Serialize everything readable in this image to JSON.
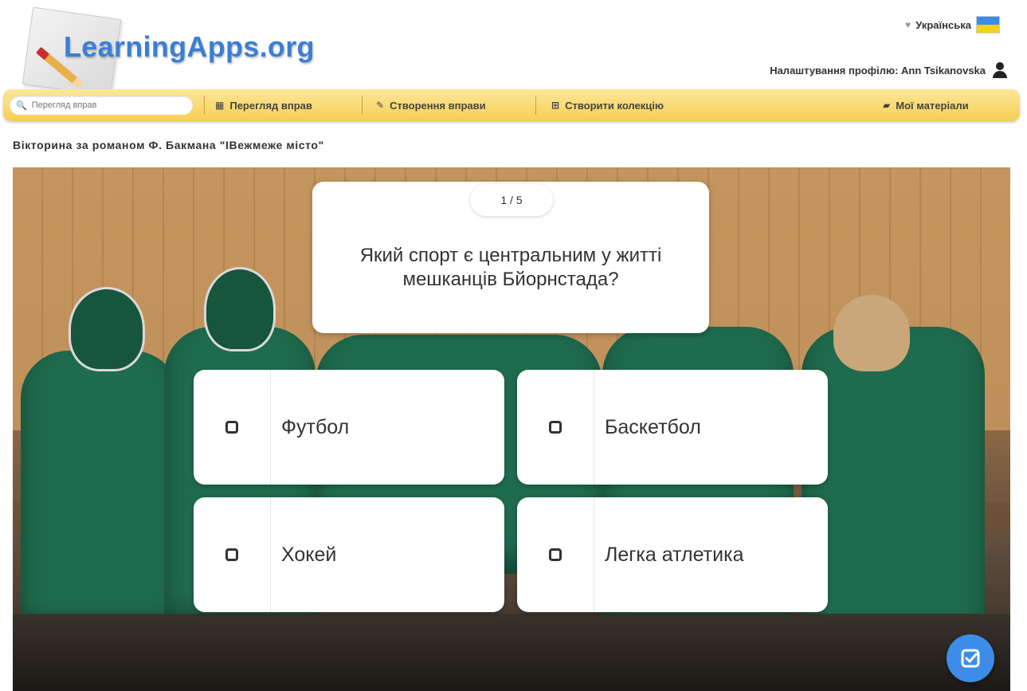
{
  "header": {
    "logo_text": "LearningApps.org",
    "language": "Українська",
    "profile_label": "Налаштування профілю: Ann Tsikanovska"
  },
  "nav": {
    "search_placeholder": "Перегляд вправ",
    "items": [
      {
        "label": "Перегляд вправ",
        "icon": "grid-icon"
      },
      {
        "label": "Створення вправи",
        "icon": "pencil-icon"
      },
      {
        "label": "Створити колекцію",
        "icon": "collection-icon"
      },
      {
        "label": "Мої матеріали",
        "icon": "folder-icon"
      }
    ]
  },
  "page": {
    "title": "Вікторина за романом Ф. Бакмана \"IВежмеже місто\""
  },
  "quiz": {
    "counter": "1 / 5",
    "question": "Який спорт є центральним у житті мешканців Бйорнстада?",
    "answers": [
      "Футбол",
      "Баскетбол",
      "Хокей",
      "Легка атлетика"
    ]
  },
  "colors": {
    "nav_bar": "#f6cf52",
    "logo_text": "#3a7fd4",
    "check_button": "#3d8de8"
  }
}
